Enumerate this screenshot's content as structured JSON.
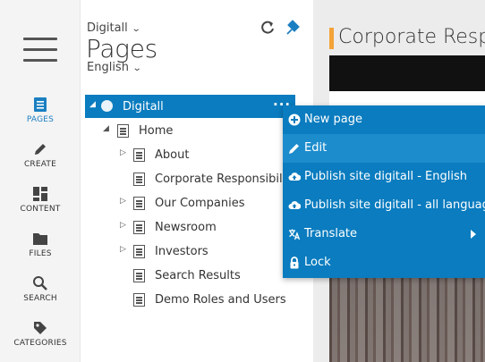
{
  "rail": {
    "items": [
      {
        "label": "PAGES",
        "icon": "pages-icon"
      },
      {
        "label": "CREATE",
        "icon": "pencil-icon"
      },
      {
        "label": "CONTENT",
        "icon": "content-icon"
      },
      {
        "label": "FILES",
        "icon": "folder-icon"
      },
      {
        "label": "SEARCH",
        "icon": "search-icon"
      },
      {
        "label": "CATEGORIES",
        "icon": "tag-icon"
      }
    ]
  },
  "header": {
    "site": "Digitall",
    "title": "Pages",
    "language": "English"
  },
  "tree": {
    "root": "Digitall",
    "more": "···",
    "items": [
      {
        "label": "Home"
      },
      {
        "label": "About"
      },
      {
        "label": "Corporate Responsibility"
      },
      {
        "label": "Our Companies"
      },
      {
        "label": "Newsroom"
      },
      {
        "label": "Investors"
      },
      {
        "label": "Search Results"
      },
      {
        "label": "Demo Roles and Users"
      }
    ]
  },
  "menu": {
    "items": [
      {
        "label": "New page",
        "icon": "plus-circle-icon"
      },
      {
        "label": "Edit",
        "icon": "pencil-icon"
      },
      {
        "label": "Publish site digitall - English",
        "icon": "cloud-upload-icon"
      },
      {
        "label": "Publish site digitall - all languages",
        "icon": "cloud-upload-icon"
      },
      {
        "label": "Translate",
        "icon": "translate-icon"
      },
      {
        "label": "Lock",
        "icon": "lock-icon"
      }
    ]
  },
  "preview": {
    "title": "Corporate Resp"
  },
  "colors": {
    "accent": "#0a7cbf",
    "accent_hover": "#1d8ccc",
    "title_bar": "#f4a338",
    "active_rail": "#1a7fc1"
  }
}
